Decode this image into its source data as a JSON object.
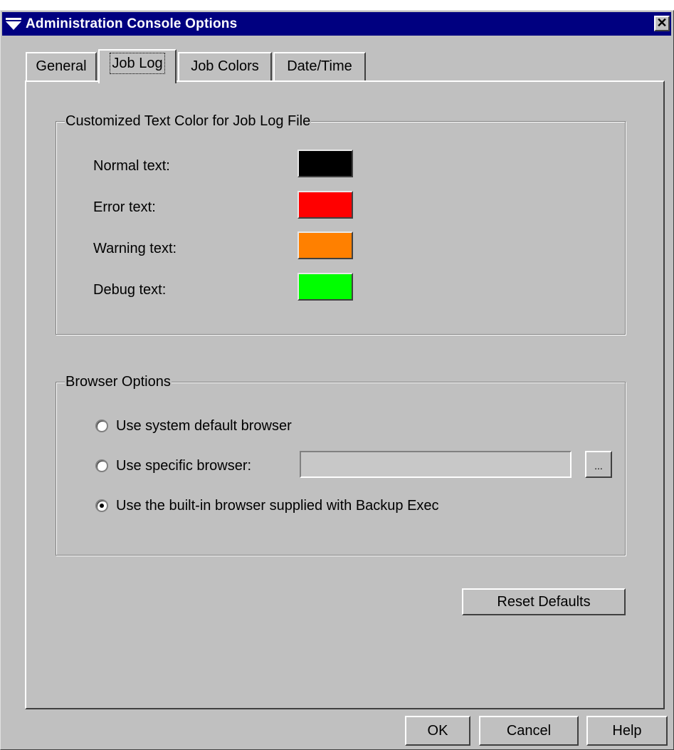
{
  "window": {
    "title": "Administration Console Options",
    "close_label": "✕"
  },
  "tabs": [
    {
      "label": "General",
      "active": false
    },
    {
      "label": "Job Log",
      "active": true
    },
    {
      "label": "Job Colors",
      "active": false
    },
    {
      "label": "Date/Time",
      "active": false
    }
  ],
  "text_colors": {
    "title": "Customized Text Color for Job Log File",
    "items": [
      {
        "label": "Normal text:",
        "color": "#000000"
      },
      {
        "label": "Error text:",
        "color": "#ff0000"
      },
      {
        "label": "Warning text:",
        "color": "#ff8000"
      },
      {
        "label": "Debug text:",
        "color": "#00ff00"
      }
    ]
  },
  "browser": {
    "title": "Browser Options",
    "options": [
      {
        "label": "Use system default browser",
        "selected": false
      },
      {
        "label": "Use specific browser:",
        "selected": false
      },
      {
        "label": "Use the built-in browser supplied with Backup Exec",
        "selected": true
      }
    ],
    "path_value": "",
    "browse_label": "..."
  },
  "buttons": {
    "reset": "Reset Defaults",
    "ok": "OK",
    "cancel": "Cancel",
    "help": "Help"
  }
}
